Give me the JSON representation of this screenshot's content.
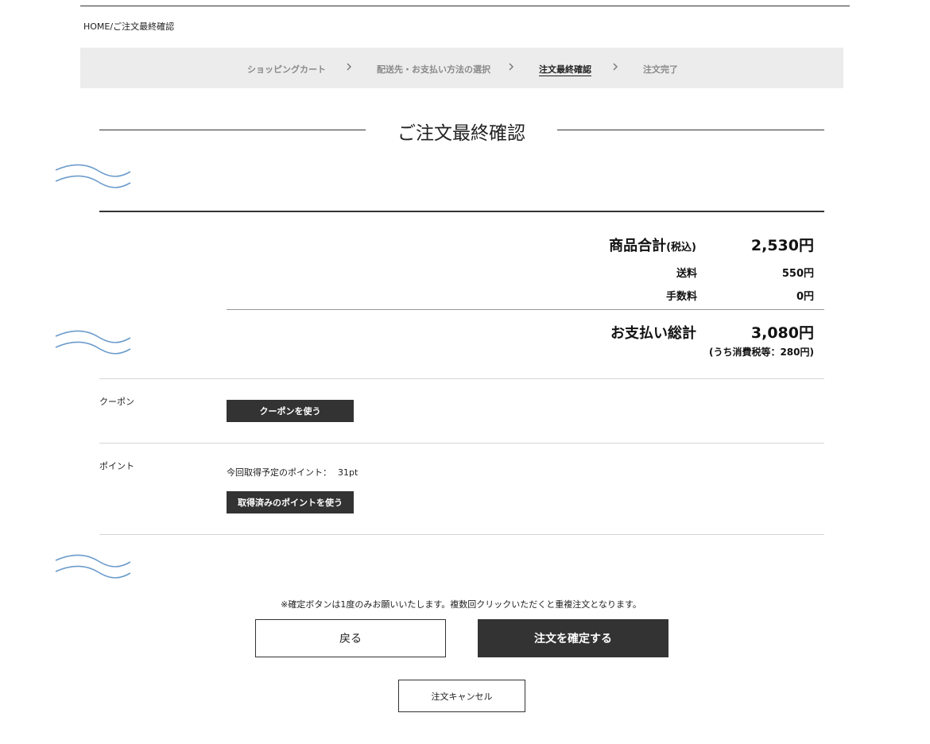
{
  "breadcrumb": {
    "home": "HOME",
    "separator": "/",
    "current": "ご注文最終確認"
  },
  "steps": [
    {
      "label": "ショッピングカート"
    },
    {
      "label": "配送先・お支払い方法の選択"
    },
    {
      "label": "注文最終確認"
    },
    {
      "label": "注文完了"
    }
  ],
  "page_title": "ご注文最終確認",
  "summary": {
    "subtotal_label": "商品合計",
    "subtotal_suffix": "(税込)",
    "subtotal_value": "2,530円",
    "shipping_label": "送料",
    "shipping_value": "550円",
    "fee_label": "手数料",
    "fee_value": "0円",
    "total_label": "お支払い総計",
    "total_value": "3,080円",
    "tax_note": "(うち消費税等：280円)"
  },
  "coupon": {
    "label": "クーポン",
    "button": "クーポンを使う"
  },
  "points": {
    "label": "ポイント",
    "info_label": "今回取得予定のポイント：",
    "info_value": "31pt",
    "button": "取得済みのポイントを使う"
  },
  "notice": "※確定ボタンは1度のみお願いいたします。複数回クリックいただくと重複注文となります。",
  "actions": {
    "back": "戻る",
    "confirm": "注文を確定する",
    "cancel": "注文キャンセル"
  },
  "colors": {
    "accent_dark": "#333333",
    "step_bg": "#ececec",
    "wave": "#6b9ccc"
  }
}
